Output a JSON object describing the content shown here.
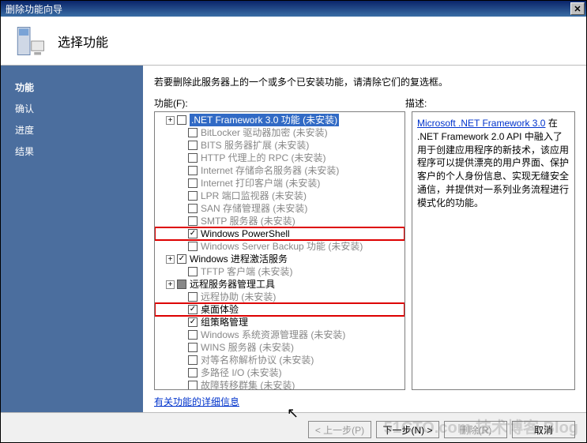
{
  "window": {
    "title": "删除功能向导"
  },
  "header": {
    "title": "选择功能"
  },
  "sidebar": {
    "steps": [
      {
        "label": "功能",
        "active": true
      },
      {
        "label": "确认"
      },
      {
        "label": "进度"
      },
      {
        "label": "结果"
      }
    ]
  },
  "main": {
    "instruction": "若要删除此服务器上的一个或多个已安装功能，请清除它们的复选框。",
    "features_label": "功能(F):",
    "description_label": "描述:",
    "more_link": "有关功能的详细信息"
  },
  "tree": [
    {
      "indent": 1,
      "exp": "+",
      "cb": "unchecked",
      "label": ".NET Framework 3.0 功能",
      "suffix": "(未安装)",
      "selected": true
    },
    {
      "indent": 2,
      "cb": "unchecked",
      "label": "BitLocker 驱动器加密",
      "suffix": "(未安装)",
      "dim": true
    },
    {
      "indent": 2,
      "cb": "unchecked",
      "label": "BITS 服务器扩展",
      "suffix": "(未安装)",
      "dim": true
    },
    {
      "indent": 2,
      "cb": "unchecked",
      "label": "HTTP 代理上的 RPC",
      "suffix": "(未安装)",
      "dim": true
    },
    {
      "indent": 2,
      "cb": "unchecked",
      "label": "Internet 存储命名服务器",
      "suffix": "(未安装)",
      "dim": true
    },
    {
      "indent": 2,
      "cb": "unchecked",
      "label": "Internet 打印客户端",
      "suffix": "(未安装)",
      "dim": true
    },
    {
      "indent": 2,
      "cb": "unchecked",
      "label": "LPR 端口监视器",
      "suffix": "(未安装)",
      "dim": true
    },
    {
      "indent": 2,
      "cb": "unchecked",
      "label": "SAN 存储管理器",
      "suffix": "(未安装)",
      "dim": true
    },
    {
      "indent": 2,
      "cb": "unchecked",
      "label": "SMTP 服务器",
      "suffix": "(未安装)",
      "dim": true
    },
    {
      "indent": 2,
      "cb": "checked",
      "label": "Windows PowerShell",
      "highlight": true
    },
    {
      "indent": 2,
      "cb": "unchecked",
      "label": "Windows Server Backup 功能",
      "suffix": "(未安装)",
      "dim": true
    },
    {
      "indent": 1,
      "exp": "+",
      "cb": "checked",
      "label": "Windows 进程激活服务"
    },
    {
      "indent": 2,
      "cb": "unchecked",
      "label": "TFTP 客户端",
      "suffix": "(未安装)",
      "dim": true
    },
    {
      "indent": 1,
      "exp": "+",
      "cb": "mixed",
      "label": "远程服务器管理工具"
    },
    {
      "indent": 2,
      "cb": "unchecked",
      "label": "远程协助",
      "suffix": "(未安装)",
      "dim": true
    },
    {
      "indent": 2,
      "cb": "checked",
      "label": "桌面体验",
      "highlight": true
    },
    {
      "indent": 2,
      "cb": "checked",
      "label": "组策略管理"
    },
    {
      "indent": 2,
      "cb": "unchecked",
      "label": "Windows 系统资源管理器",
      "suffix": "(未安装)",
      "dim": true
    },
    {
      "indent": 2,
      "cb": "unchecked",
      "label": "WINS 服务器",
      "suffix": "(未安装)",
      "dim": true
    },
    {
      "indent": 2,
      "cb": "unchecked",
      "label": "对等名称解析协议",
      "suffix": "(未安装)",
      "dim": true
    },
    {
      "indent": 2,
      "cb": "unchecked",
      "label": "多路径 I/O",
      "suffix": "(未安装)",
      "dim": true
    },
    {
      "indent": 2,
      "cb": "unchecked",
      "label": "故障转移群集",
      "suffix": "(未安装)",
      "dim": true
    }
  ],
  "description": {
    "link": "Microsoft .NET Framework 3.0",
    "text": "在 .NET Framework 2.0 API 中融入了用于创建应用程序的新技术，该应用程序可以提供漂亮的用户界面、保护客户的个人身份信息、实现无缝安全通信，并提供对一系列业务流程进行模式化的功能。"
  },
  "buttons": {
    "prev": "< 上一步(P)",
    "next": "下一步(N) >",
    "remove": "删除(R)",
    "cancel": "取消"
  },
  "watermark": "51CTO.com 技术博客 Blog"
}
